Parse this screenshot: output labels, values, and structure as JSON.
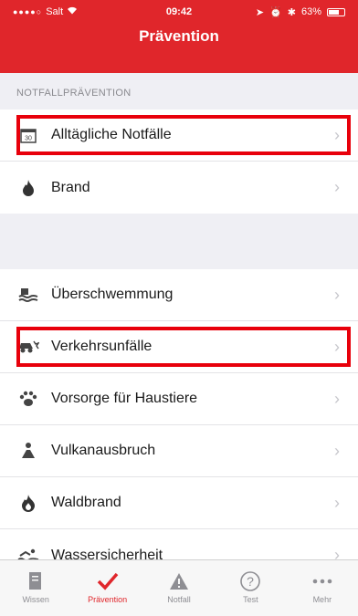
{
  "status": {
    "carrier": "Salt",
    "time": "09:42",
    "battery": "63%"
  },
  "header": {
    "title": "Prävention"
  },
  "section": {
    "title": "NOTFALLPRÄVENTION"
  },
  "group1": [
    {
      "label": "Alltägliche Notfälle",
      "icon": "calendar-icon",
      "highlighted": true
    },
    {
      "label": "Brand",
      "icon": "fire-icon",
      "highlighted": false
    }
  ],
  "group2": [
    {
      "label": "Überschwemmung",
      "icon": "flood-icon",
      "highlighted": false
    },
    {
      "label": "Verkehrsunfälle",
      "icon": "car-crash-icon",
      "highlighted": true
    },
    {
      "label": "Vorsorge für Haustiere",
      "icon": "paw-icon",
      "highlighted": false
    },
    {
      "label": "Vulkanausbruch",
      "icon": "volcano-icon",
      "highlighted": false
    },
    {
      "label": "Waldbrand",
      "icon": "wildfire-icon",
      "highlighted": false
    },
    {
      "label": "Wassersicherheit",
      "icon": "swimming-icon",
      "highlighted": false
    }
  ],
  "tabs": [
    {
      "label": "Wissen",
      "icon": "book-icon",
      "active": false
    },
    {
      "label": "Prävention",
      "icon": "checkmark-icon",
      "active": true
    },
    {
      "label": "Notfall",
      "icon": "warning-icon",
      "active": false
    },
    {
      "label": "Test",
      "icon": "question-icon",
      "active": false
    },
    {
      "label": "Mehr",
      "icon": "more-icon",
      "active": false
    }
  ],
  "colors": {
    "brand": "#e0262b",
    "highlight": "#e8000b"
  }
}
